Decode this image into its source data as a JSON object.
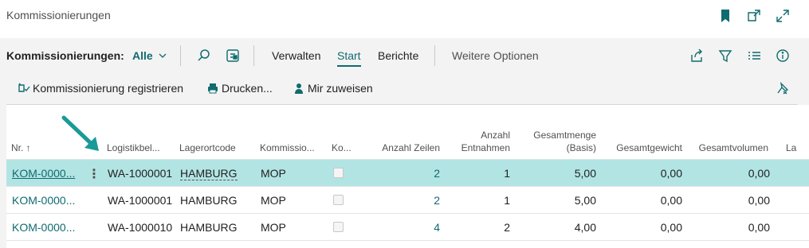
{
  "page": {
    "title": "Kommissionierungen"
  },
  "title_icons": [
    "bookmark-icon",
    "open-new-window-icon",
    "expand-icon"
  ],
  "actionbar": {
    "list_label": "Kommissionierungen:",
    "filter_value": "Alle",
    "tabs": [
      "Verwalten",
      "Start",
      "Berichte"
    ],
    "active_tab": "Start",
    "more_options": "Weitere Optionen"
  },
  "promoted_actions": {
    "register": "Kommissionierung registrieren",
    "print": "Drucken...",
    "assign": "Mir zuweisen"
  },
  "columns": {
    "nr": "Nr. ↑",
    "source": "Logistikbel...",
    "location": "Lagerortcode",
    "picker": "Kommissio...",
    "ko": "Ko...",
    "lines": "Anzahl Zeilen",
    "picks_1": "Anzahl",
    "picks_2": "Entnahmen",
    "qty_1": "Gesamtmenge",
    "qty_2": "(Basis)",
    "weight": "Gesamtgewicht",
    "volume": "Gesamtvolumen",
    "la": "La"
  },
  "rows": [
    {
      "nr": "KOM-0000...",
      "source": "WA-1000001",
      "location": "HAMBURG",
      "picker": "MOP",
      "lines": "2",
      "picks": "1",
      "qty": "5,00",
      "weight": "0,00",
      "volume": "0,00",
      "selected": true
    },
    {
      "nr": "KOM-0000...",
      "source": "WA-1000001",
      "location": "HAMBURG",
      "picker": "MOP",
      "lines": "2",
      "picks": "1",
      "qty": "5,00",
      "weight": "0,00",
      "volume": "0,00",
      "selected": false
    },
    {
      "nr": "KOM-0000...",
      "source": "WA-1000010",
      "location": "HAMBURG",
      "picker": "MOP",
      "lines": "4",
      "picks": "2",
      "qty": "4,00",
      "weight": "0,00",
      "volume": "0,00",
      "selected": false
    }
  ],
  "colors": {
    "accent": "#0f6b6f",
    "selected_row": "#b3e4e4",
    "arrow": "#1a9a97"
  }
}
